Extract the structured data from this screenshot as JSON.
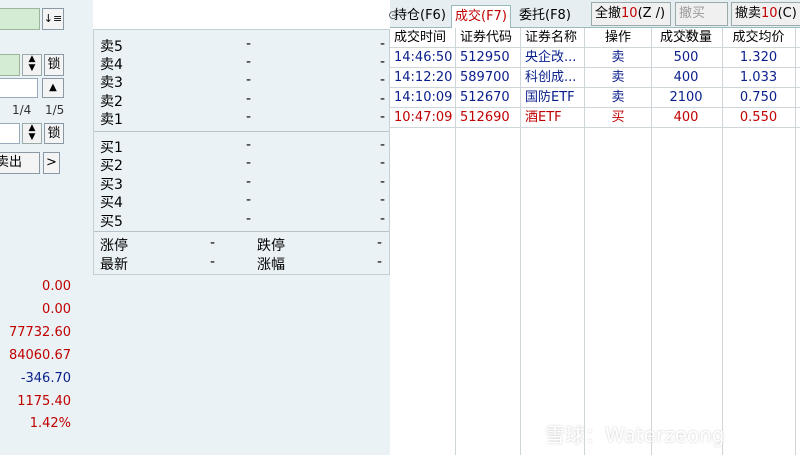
{
  "left": {
    "sort_icon_glyph": "↓≡",
    "lock_label_1": "锁",
    "lock_label_2": "锁",
    "up_arrow": "▲",
    "fraction_1": "1/4",
    "fraction_2": "1/5",
    "sell_button_label": "卖出",
    "next_button_label": ">",
    "values": [
      "0.00",
      "0.00",
      "77732.60",
      "84060.67",
      "-346.70",
      "1175.40",
      "1.42%"
    ]
  },
  "quote": {
    "sell_rows": [
      {
        "label": "卖5",
        "price": "-",
        "vol": "-"
      },
      {
        "label": "卖4",
        "price": "-",
        "vol": "-"
      },
      {
        "label": "卖3",
        "price": "-",
        "vol": "-"
      },
      {
        "label": "卖2",
        "price": "-",
        "vol": "-"
      },
      {
        "label": "卖1",
        "price": "-",
        "vol": "-"
      }
    ],
    "buy_rows": [
      {
        "label": "买1",
        "price": "-",
        "vol": "-"
      },
      {
        "label": "买2",
        "price": "-",
        "vol": "-"
      },
      {
        "label": "买3",
        "price": "-",
        "vol": "-"
      },
      {
        "label": "买4",
        "price": "-",
        "vol": "-"
      },
      {
        "label": "买5",
        "price": "-",
        "vol": "-"
      }
    ],
    "limit_up_label": "涨停",
    "limit_up_value": "-",
    "limit_down_label": "跌停",
    "limit_down_value": "-",
    "latest_label": "最新",
    "latest_value": "-",
    "change_label": "涨幅",
    "change_value": "-"
  },
  "tabs": {
    "positions": "持仓(F6)",
    "trades": "成交(F7)",
    "orders": "委托(F8)",
    "cancel_all": "全撤",
    "cancel_all_count": "10",
    "cancel_all_key": "(Z /)",
    "cancel_buy": "撤买(X)",
    "cancel_sell": "撤卖",
    "cancel_sell_count": "10",
    "cancel_sell_key": "(C)"
  },
  "table": {
    "headers": [
      "成交时间",
      "证券代码",
      "证券名称",
      "操作",
      "成交数量",
      "成交均价"
    ],
    "rows": [
      {
        "time": "14:46:50",
        "code": "512950",
        "name": "央企改...",
        "op": "卖",
        "qty": "500",
        "avg": "1.320",
        "side": "sell"
      },
      {
        "time": "14:12:20",
        "code": "589700",
        "name": "科创成...",
        "op": "卖",
        "qty": "400",
        "avg": "1.033",
        "side": "sell"
      },
      {
        "time": "14:10:09",
        "code": "512670",
        "name": "国防ETF",
        "op": "卖",
        "qty": "2100",
        "avg": "0.750",
        "side": "sell"
      },
      {
        "time": "10:47:09",
        "code": "512690",
        "name": "酒ETF",
        "op": "买",
        "qty": "400",
        "avg": "0.550",
        "side": "buy"
      }
    ]
  },
  "colors": {
    "buy": "#c00000",
    "sell": "#0a1e8c",
    "panel_bg": "#eaf2f5"
  },
  "watermark": "雪球：Waterzeong"
}
